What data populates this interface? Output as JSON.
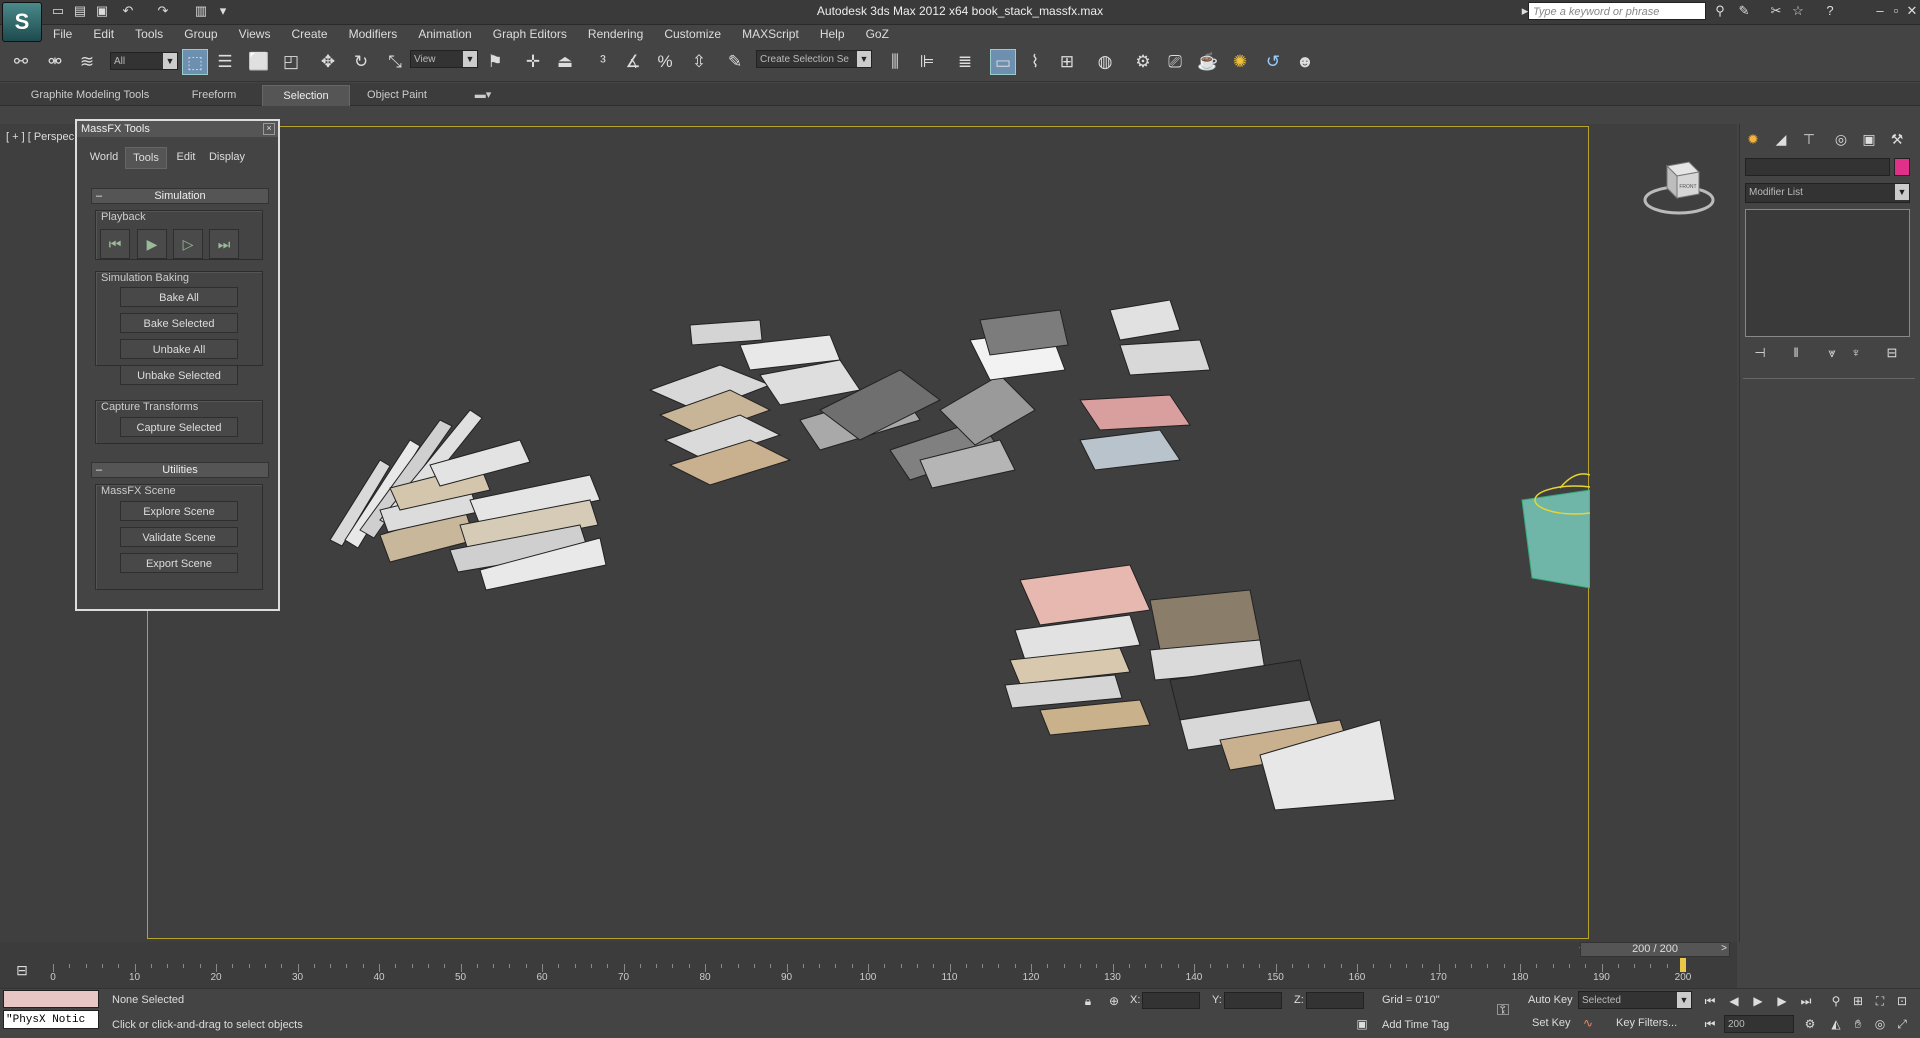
{
  "window": {
    "title": "Autodesk 3ds Max  2012 x64     book_stack_massfx.max",
    "search_placeholder": "Type a keyword or phrase"
  },
  "app_logo": "S",
  "menu": [
    "File",
    "Edit",
    "Tools",
    "Group",
    "Views",
    "Create",
    "Modifiers",
    "Animation",
    "Graph Editors",
    "Rendering",
    "Customize",
    "MAXScript",
    "Help",
    "GoZ"
  ],
  "toolbar": {
    "selection_filter": "All",
    "ref_coord": "View",
    "named_selection_placeholder": "Create Selection Se"
  },
  "ribbon_tabs": [
    "Graphite Modeling Tools",
    "Freeform",
    "Selection",
    "Object Paint"
  ],
  "viewport": {
    "label": "[ + ] [ Perspec",
    "viewcube_label": "FRONT"
  },
  "massfx": {
    "title": "MassFX Tools",
    "tabs": [
      "World",
      "Tools",
      "Edit",
      "Display"
    ],
    "simulation_header": "Simulation",
    "playback_label": "Playback",
    "baking_label": "Simulation Baking",
    "baking_buttons": [
      "Bake All",
      "Bake Selected",
      "Unbake All",
      "Unbake Selected"
    ],
    "capture_label": "Capture Transforms",
    "capture_button": "Capture Selected",
    "utilities_header": "Utilities",
    "scene_label": "MassFX Scene",
    "scene_buttons": [
      "Explore Scene",
      "Validate Scene",
      "Export Scene"
    ]
  },
  "command_panel": {
    "modifier_list": "Modifier List"
  },
  "timeline": {
    "frame_slider": "200 / 200",
    "ticks": [
      0,
      10,
      20,
      30,
      40,
      50,
      60,
      70,
      80,
      90,
      100,
      110,
      120,
      130,
      140,
      150,
      160,
      170,
      180,
      190,
      200
    ]
  },
  "status": {
    "selection": "None Selected",
    "prompt": "Click or click-and-drag to select objects",
    "physx_notice": "\"PhysX Notic",
    "x_label": "X:",
    "y_label": "Y:",
    "z_label": "Z:",
    "grid": "Grid = 0'10\"",
    "add_time_tag": "Add Time Tag",
    "auto_key": "Auto Key",
    "set_key": "Set Key",
    "key_mode": "Selected",
    "key_filters": "Key Filters...",
    "current_frame": "200"
  }
}
